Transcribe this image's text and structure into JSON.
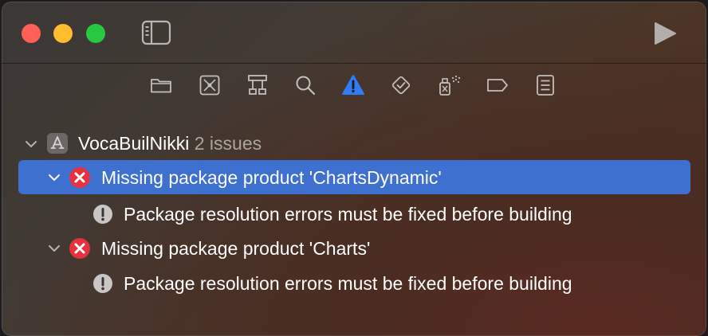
{
  "project": {
    "name": "VocaBuilNikki",
    "issue_count": "2 issues"
  },
  "issues": [
    {
      "title": "Missing package product 'ChartsDynamic'",
      "severity": "error",
      "selected": true,
      "detail": "Package resolution errors must be fixed before building"
    },
    {
      "title": "Missing package product 'Charts'",
      "severity": "error",
      "selected": false,
      "detail": "Package resolution errors must be fixed before building"
    }
  ],
  "navigator_tabs": [
    {
      "icon": "folder-icon",
      "active": false
    },
    {
      "icon": "source-control-icon",
      "active": false
    },
    {
      "icon": "hierarchy-icon",
      "active": false
    },
    {
      "icon": "search-icon",
      "active": false
    },
    {
      "icon": "warning-triangle-icon",
      "active": true
    },
    {
      "icon": "test-diamond-icon",
      "active": false
    },
    {
      "icon": "debug-spray-icon",
      "active": false
    },
    {
      "icon": "breakpoint-tag-icon",
      "active": false
    },
    {
      "icon": "report-list-icon",
      "active": false
    }
  ],
  "colors": {
    "accent": "#3d70cf",
    "error": "#e5323f",
    "warning_tab": "#2f7cf6"
  }
}
